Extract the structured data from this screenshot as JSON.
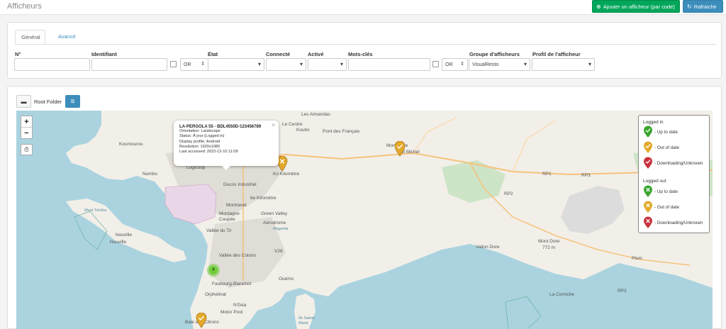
{
  "header": {
    "title": "Afficheurs",
    "add_button": "Ajouter un afficheur (par code)",
    "refresh_button": "Rafraichir"
  },
  "filters": {
    "tabs": [
      "Général",
      "Avancé"
    ],
    "labels": {
      "number": "N°",
      "identifier": "Identifiant",
      "state": "État",
      "connected": "Connecté",
      "active": "Activé",
      "keywords": "Mots-clés",
      "group": "Groupe d'afficheurs",
      "profile": "Profil de l'afficheur"
    },
    "identifier_operator": "OR",
    "keywords_operator": "OR",
    "group_value": "VisualResto"
  },
  "map_panel": {
    "folder_label": "Root Folder"
  },
  "map": {
    "labels": {
      "les_almandas": "Les Almandas",
      "centre": "Le Centre",
      "koutio": "Koutio",
      "pont_francais": "Pont des Français",
      "mont_dore": "Mont Dore",
      "st_michel": "St Michel",
      "koumourou": "Koumourou",
      "numbo": "Numbo",
      "logicoop": "Logicoop",
      "ko_metre": "Ko Kilomètre",
      "ducos": "Ducos Industriel",
      "sixieme_km": "6e Kilomètre",
      "montravel": "Montravel",
      "green_valley": "Green Valley",
      "montagne": "Montagne Coupée",
      "aerodrome": "Aérodrome",
      "magenta": "Magenta",
      "vallee_tir": "Vallée du Tir",
      "mont_tereka": "Mont Téréka",
      "nouville": "Nouville",
      "vallee_colons": "Vallée des Colons",
      "nouville_2": "Nouville",
      "faubourg": "Faubourg-Blanchot",
      "ouemo": "Ouémo",
      "orphelinat": "Orphelinat",
      "ngea": "N'Géa",
      "motor_pool": "Motor Pool",
      "baie_citrons": "Baie des Citrons",
      "ile_sainte_marie": "Île Sainte Marie",
      "vallon_dore": "Vallon Dore",
      "mont_dore_peak": "Mont Dore",
      "mont_dore_alt": "772 m",
      "plum": "Plum",
      "la_corniche": "La Corniche",
      "rp1": "RP1",
      "rp3": "RP3",
      "rp2a": "RP2",
      "rp2b": "RP2",
      "v28": "V28"
    },
    "popup": {
      "title": "LA-PERGOLA 55 - BDL4550D-123456789",
      "lines": [
        "Orientation: Landscape",
        "Status: À jour (Logged in)",
        "Display profile: Android",
        "Resolution: 1920x1080",
        "Last accessed: 2022-12-10 11:09"
      ]
    },
    "cluster_count": "4",
    "legend": {
      "logged_in": "Logged in",
      "logged_out": "Logged out",
      "items_in": [
        "- Up to date",
        "- Out of date",
        "- Downloading/Unknown"
      ],
      "items_out": [
        "- Up to date",
        "- Out of date",
        "- Downloading/Unknown"
      ]
    },
    "colors": {
      "up_to_date": "#3aa52f",
      "out_of_date": "#e3a92a",
      "downloading": "#c9323c",
      "water": "#aad3df",
      "land": "#f2efe9"
    }
  }
}
